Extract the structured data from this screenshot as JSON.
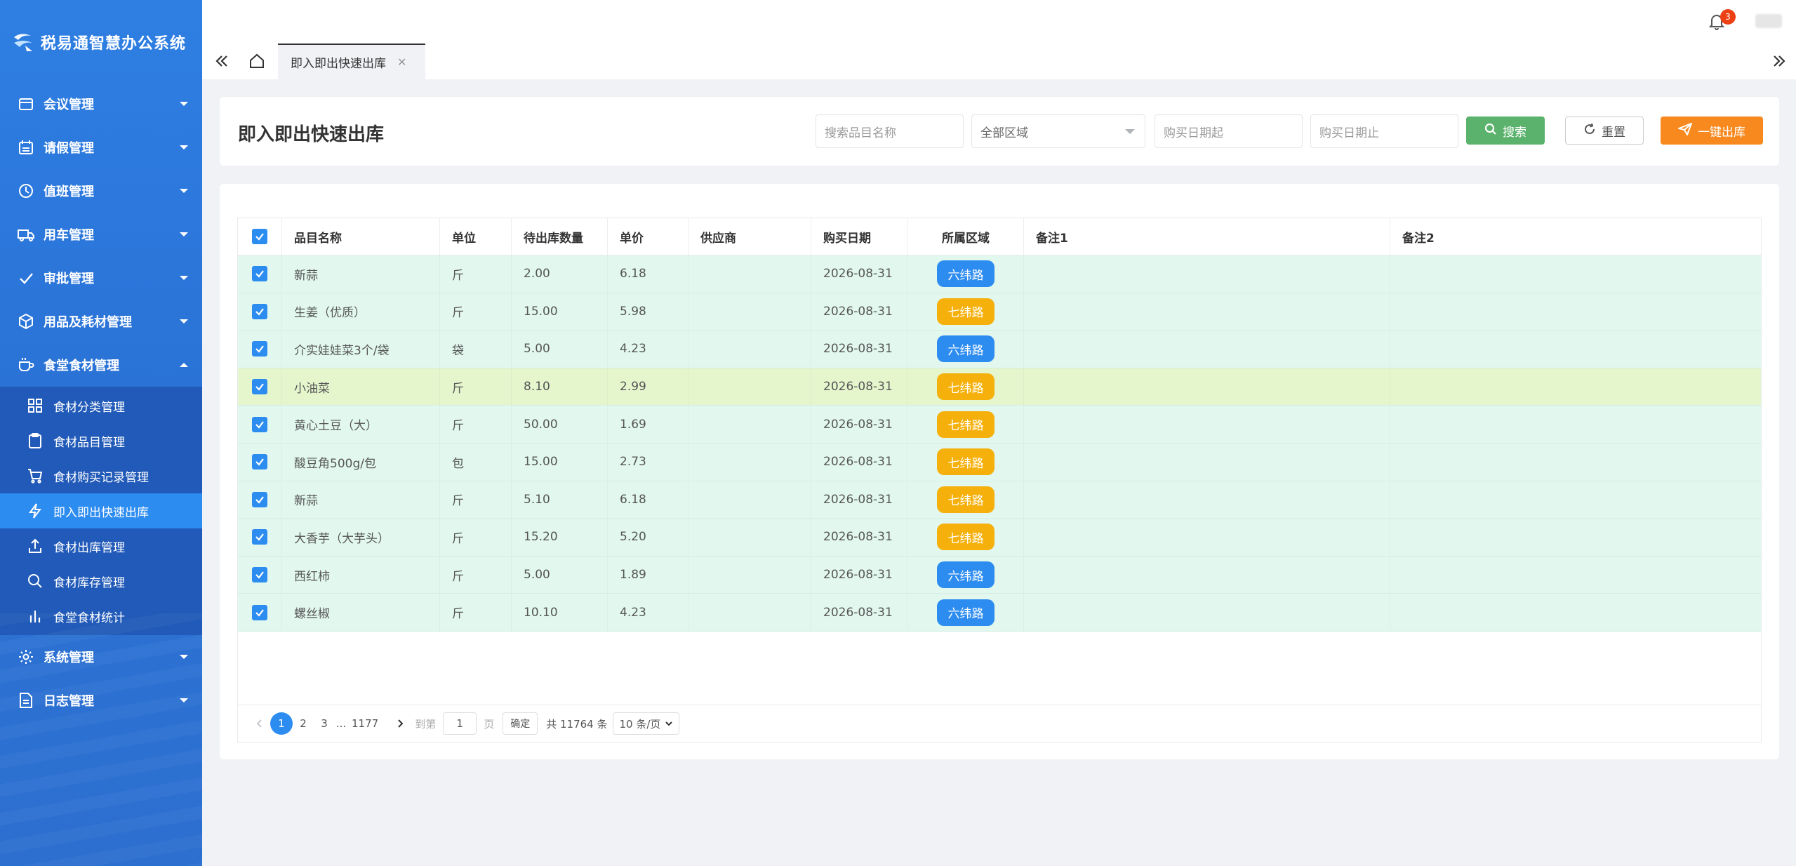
{
  "app": {
    "title": "税易通智慧办公系统"
  },
  "topbar": {
    "notification_count": "3"
  },
  "tabs": [
    {
      "label": "即入即出快速出库"
    }
  ],
  "sidebar": {
    "items": [
      {
        "label": "会议管理",
        "icon": "calendar-icon"
      },
      {
        "label": "请假管理",
        "icon": "calendar-grid-icon"
      },
      {
        "label": "值班管理",
        "icon": "clock-icon"
      },
      {
        "label": "用车管理",
        "icon": "truck-icon"
      },
      {
        "label": "审批管理",
        "icon": "check-icon"
      },
      {
        "label": "用品及耗材管理",
        "icon": "box-icon"
      },
      {
        "label": "食堂食材管理",
        "icon": "cup-icon",
        "expanded": true
      },
      {
        "label": "系统管理",
        "icon": "gear-icon"
      },
      {
        "label": "日志管理",
        "icon": "document-icon"
      }
    ],
    "submenu": [
      {
        "label": "食材分类管理",
        "icon": "grid-icon"
      },
      {
        "label": "食材品目管理",
        "icon": "clipboard-icon"
      },
      {
        "label": "食材购买记录管理",
        "icon": "cart-icon"
      },
      {
        "label": "即入即出快速出库",
        "icon": "lightning-icon",
        "active": true
      },
      {
        "label": "食材出库管理",
        "icon": "upload-icon"
      },
      {
        "label": "食材库存管理",
        "icon": "search-icon"
      },
      {
        "label": "食堂食材统计",
        "icon": "bar-chart-icon"
      }
    ]
  },
  "page": {
    "title": "即入即出快速出库",
    "search_placeholder": "搜索品目名称",
    "area_select": "全部区域",
    "date_start_placeholder": "购买日期起",
    "date_end_placeholder": "购买日期止",
    "search_label": "搜索",
    "reset_label": "重置",
    "out_label": "一键出库"
  },
  "table": {
    "columns": [
      "品目名称",
      "单位",
      "待出库数量",
      "单价",
      "供应商",
      "购买日期",
      "所属区域",
      "备注1",
      "备注2"
    ],
    "rows": [
      {
        "name": "新蒜",
        "unit": "斤",
        "qty": "2.00",
        "price": "6.18",
        "supplier": "",
        "date": "2026-08-31",
        "area": "六纬路",
        "area_color": "#2d8cf0"
      },
      {
        "name": "生姜（优质）",
        "unit": "斤",
        "qty": "15.00",
        "price": "5.98",
        "supplier": "",
        "date": "2026-08-31",
        "area": "七纬路",
        "area_color": "#f5b00b"
      },
      {
        "name": "介实娃娃菜3个/袋",
        "unit": "袋",
        "qty": "5.00",
        "price": "4.23",
        "supplier": "",
        "date": "2026-08-31",
        "area": "六纬路",
        "area_color": "#2d8cf0"
      },
      {
        "name": "小油菜",
        "unit": "斤",
        "qty": "8.10",
        "price": "2.99",
        "supplier": "",
        "date": "2026-08-31",
        "area": "七纬路",
        "area_color": "#f5b00b",
        "highlight": true
      },
      {
        "name": "黄心土豆（大）",
        "unit": "斤",
        "qty": "50.00",
        "price": "1.69",
        "supplier": "",
        "date": "2026-08-31",
        "area": "七纬路",
        "area_color": "#f5b00b"
      },
      {
        "name": "酸豆角500g/包",
        "unit": "包",
        "qty": "15.00",
        "price": "2.73",
        "supplier": "",
        "date": "2026-08-31",
        "area": "七纬路",
        "area_color": "#f5b00b"
      },
      {
        "name": "新蒜",
        "unit": "斤",
        "qty": "5.10",
        "price": "6.18",
        "supplier": "",
        "date": "2026-08-31",
        "area": "七纬路",
        "area_color": "#f5b00b"
      },
      {
        "name": "大香芋（大芋头）",
        "unit": "斤",
        "qty": "15.20",
        "price": "5.20",
        "supplier": "",
        "date": "2026-08-31",
        "area": "七纬路",
        "area_color": "#f5b00b"
      },
      {
        "name": "西红柿",
        "unit": "斤",
        "qty": "5.00",
        "price": "1.89",
        "supplier": "",
        "date": "2026-08-31",
        "area": "六纬路",
        "area_color": "#2d8cf0"
      },
      {
        "name": "螺丝椒",
        "unit": "斤",
        "qty": "10.10",
        "price": "4.23",
        "supplier": "",
        "date": "2026-08-31",
        "area": "六纬路",
        "area_color": "#2d8cf0"
      }
    ]
  },
  "pagination": {
    "pages": [
      "1",
      "2",
      "3",
      "...",
      "1177"
    ],
    "current": "1",
    "goto_label": "到第",
    "goto_value": "1",
    "page_suffix": "页",
    "confirm_label": "确定",
    "total_text": "共 11764 条",
    "page_size": "10 条/页"
  },
  "colors": {
    "sidebar": "#2a72d6",
    "active": "#2d8cf0",
    "row": "#e2f8ef",
    "row_highlight": "#e5f6cd",
    "search": "#5bb26c",
    "out": "#f7891e"
  }
}
